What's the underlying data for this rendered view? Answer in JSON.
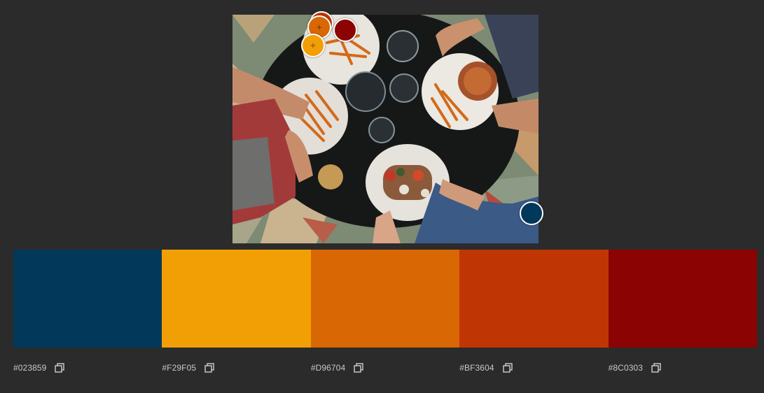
{
  "photo": {
    "icon": "food-table-photo"
  },
  "pickers": [
    {
      "name": "picker-bf3604",
      "color": "#BF3604",
      "icon": "plus-icon"
    },
    {
      "name": "picker-d96704",
      "color": "#D96704",
      "icon": "plus-icon"
    },
    {
      "name": "picker-8c0303",
      "color": "#8C0303",
      "icon": ""
    },
    {
      "name": "picker-f29f05",
      "color": "#F29F05",
      "icon": "plus-icon"
    },
    {
      "name": "picker-023859",
      "color": "#023859",
      "icon": ""
    }
  ],
  "palette": {
    "swatches": [
      {
        "hex": "#023859",
        "label": "#023859"
      },
      {
        "hex": "#F29F05",
        "label": "#F29F05"
      },
      {
        "hex": "#D96704",
        "label": "#D96704"
      },
      {
        "hex": "#BF3604",
        "label": "#BF3604"
      },
      {
        "hex": "#8C0303",
        "label": "#8C0303"
      }
    ],
    "copy_icon": "copy-icon"
  }
}
